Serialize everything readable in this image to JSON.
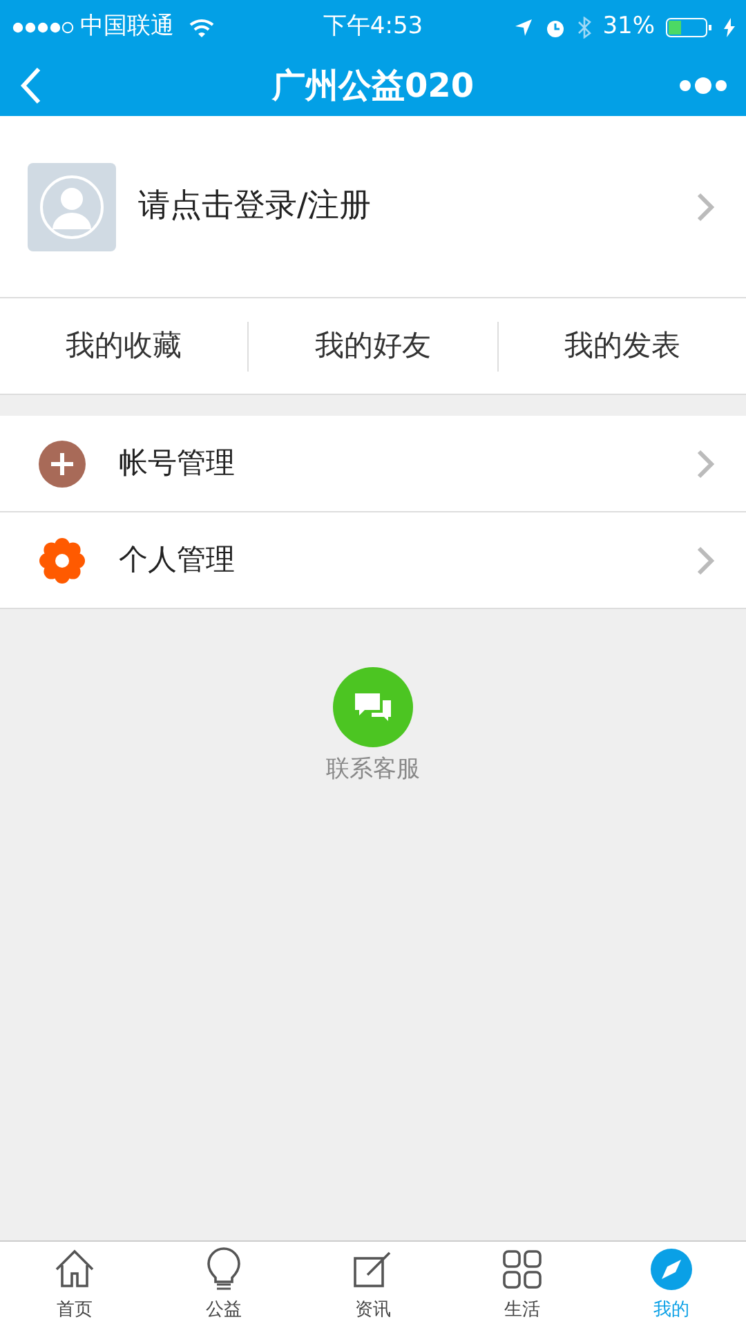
{
  "status_bar": {
    "carrier": "中国联通",
    "time": "下午4:53",
    "battery": "31%"
  },
  "nav": {
    "title": "广州公益020"
  },
  "profile": {
    "login": "请点击登录/注册"
  },
  "shortcuts": [
    "我的收藏",
    "我的好友",
    "我的发表"
  ],
  "menu": [
    {
      "label": "帐号管理",
      "kind": "plus",
      "color": "#a86a58"
    },
    {
      "label": "个人管理",
      "kind": "flower",
      "color": "#ff5a00"
    }
  ],
  "service": {
    "label": "联系客服"
  },
  "tabs": [
    {
      "label": "首页",
      "kind": "home",
      "selected": false
    },
    {
      "label": "公益",
      "kind": "bulb",
      "selected": false
    },
    {
      "label": "资讯",
      "kind": "edit",
      "selected": false
    },
    {
      "label": "生活",
      "kind": "grid",
      "selected": false
    },
    {
      "label": "我的",
      "kind": "compass",
      "selected": true
    }
  ]
}
